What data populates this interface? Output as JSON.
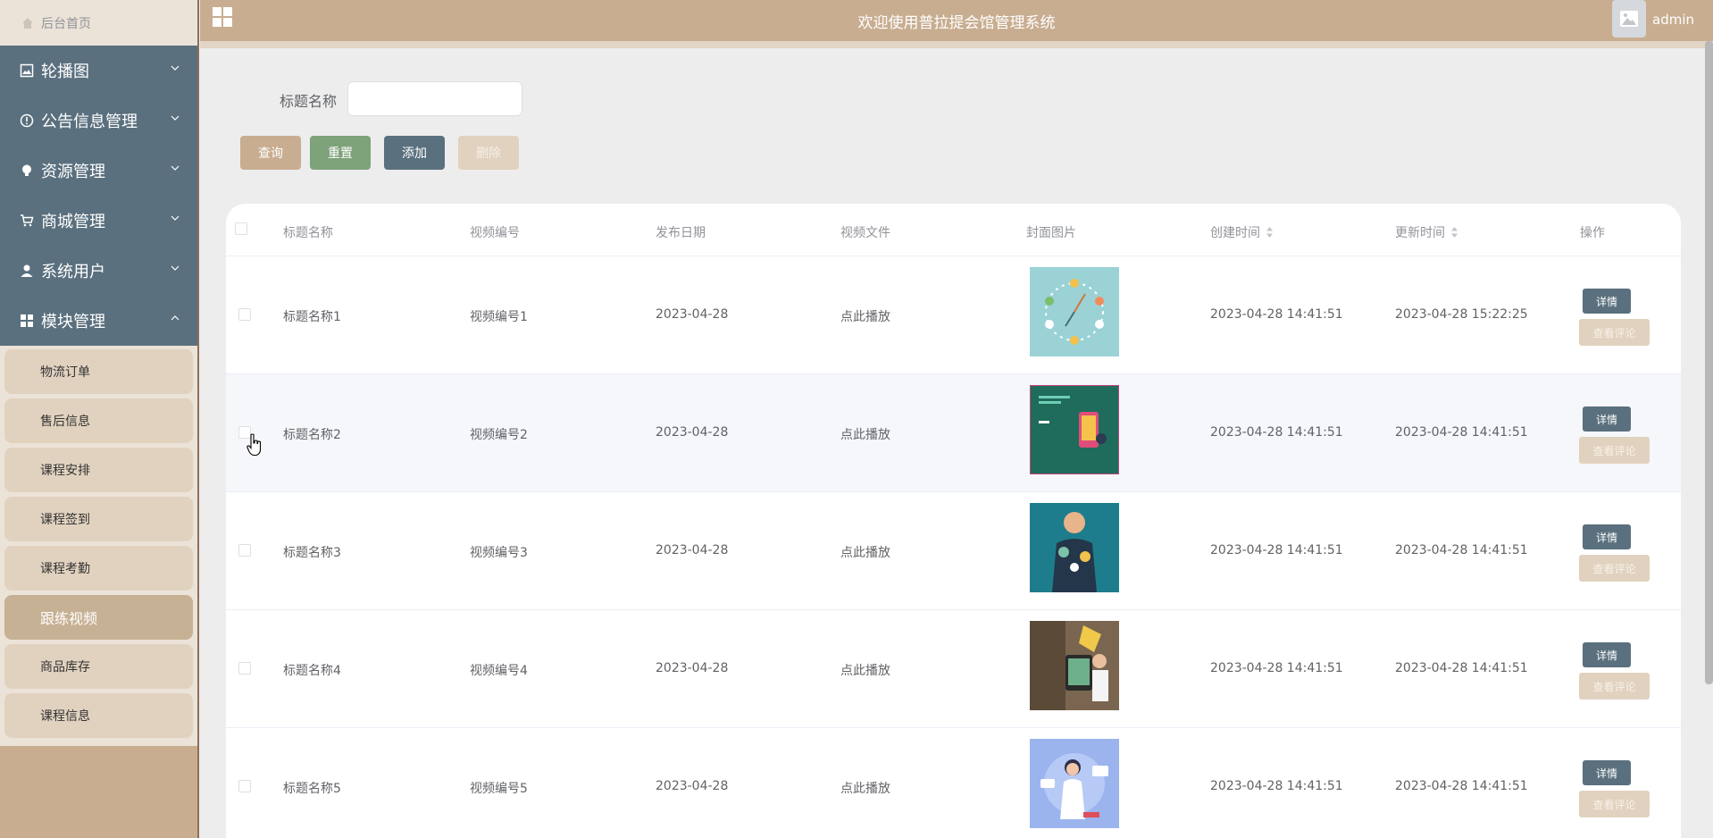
{
  "header": {
    "title": "欢迎使用普拉提会馆管理系统",
    "username": "admin"
  },
  "sidebar": {
    "home": "后台首页",
    "menus": [
      {
        "label": "轮播图",
        "icon": "image-icon"
      },
      {
        "label": "公告信息管理",
        "icon": "info-icon"
      },
      {
        "label": "资源管理",
        "icon": "bulb-icon"
      },
      {
        "label": "商城管理",
        "icon": "cart-icon"
      },
      {
        "label": "系统用户",
        "icon": "user-icon"
      },
      {
        "label": "模块管理",
        "icon": "grid-icon"
      }
    ],
    "submenu": [
      "物流订单",
      "售后信息",
      "课程安排",
      "课程签到",
      "课程考勤",
      "跟练视频",
      "商品库存",
      "课程信息"
    ],
    "active_submenu": "跟练视频"
  },
  "search": {
    "label": "标题名称",
    "value": "",
    "placeholder": ""
  },
  "buttons": {
    "query": "查询",
    "reset": "重置",
    "add": "添加",
    "delete": "删除"
  },
  "table": {
    "columns": [
      "标题名称",
      "视频编号",
      "发布日期",
      "视频文件",
      "封面图片",
      "创建时间",
      "更新时间",
      "操作"
    ],
    "rows": [
      {
        "title": "标题名称1",
        "video_no": "视频编号1",
        "publish_date": "2023-04-28",
        "video_file": "点此播放",
        "created": "2023-04-28 14:41:51",
        "updated": "2023-04-28 15:22:25",
        "cover": "clock-illustration"
      },
      {
        "title": "标题名称2",
        "video_no": "视频编号2",
        "publish_date": "2023-04-28",
        "video_file": "点此播放",
        "created": "2023-04-28 14:41:51",
        "updated": "2023-04-28 14:41:51",
        "cover": "phone-illustration"
      },
      {
        "title": "标题名称3",
        "video_no": "视频编号3",
        "publish_date": "2023-04-28",
        "video_file": "点此播放",
        "created": "2023-04-28 14:41:51",
        "updated": "2023-04-28 14:41:51",
        "cover": "person-illustration"
      },
      {
        "title": "标题名称4",
        "video_no": "视频编号4",
        "publish_date": "2023-04-28",
        "video_file": "点此播放",
        "created": "2023-04-28 14:41:51",
        "updated": "2023-04-28 14:41:51",
        "cover": "tablet-photo"
      },
      {
        "title": "标题名称5",
        "video_no": "视频编号5",
        "publish_date": "2023-04-28",
        "video_file": "点此播放",
        "created": "2023-04-28 14:41:51",
        "updated": "2023-04-28 14:41:51",
        "cover": "doctor-illustration"
      }
    ],
    "action_detail": "详情",
    "action_review": "查看评论"
  },
  "colors": {
    "primary_tan": "#c8ad90",
    "slate": "#5a707e",
    "green": "#7ea27a",
    "light_tan": "#e1d2bf"
  }
}
